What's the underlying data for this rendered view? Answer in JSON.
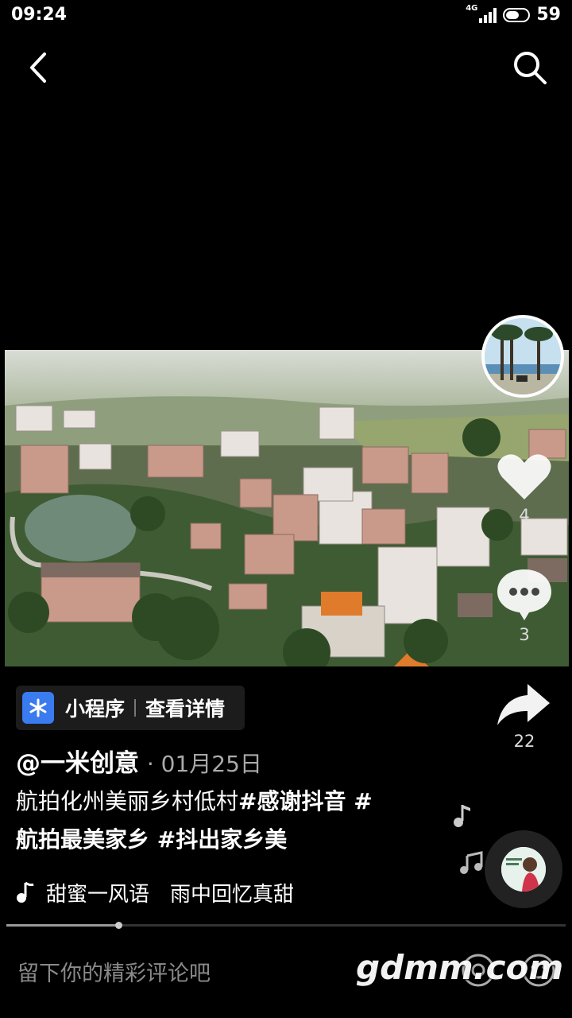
{
  "status": {
    "time": "09:24",
    "network": "4G",
    "battery": "59"
  },
  "video": {
    "scene": "aerial-village-landscape"
  },
  "author": {
    "name": "@一米创意",
    "date": "· 01月25日"
  },
  "sidebar": {
    "like_count": "4",
    "comment_count": "3",
    "share_count": "22"
  },
  "mini_program": {
    "label": "小程序",
    "action": "查看详情"
  },
  "description": {
    "text": "航拍化州美丽乡村低村",
    "tags": [
      "#感谢抖音 #",
      "航拍最美家乡 #抖出家乡美"
    ]
  },
  "music": {
    "title": "甜蜜一风语　雨中回忆真甜"
  },
  "playback": {
    "progress": 0.2
  },
  "comment_bar": {
    "placeholder": "留下你的精彩评论吧"
  },
  "watermark": "gdmm.com",
  "colors": {
    "background": "#000000",
    "mini_program_icon": "#3a7bf0",
    "text": "#ffffff"
  },
  "icons": [
    "back-icon",
    "search-icon",
    "heart-icon",
    "comment-icon",
    "share-icon",
    "music-note-icon",
    "at-icon",
    "emoji-icon"
  ]
}
